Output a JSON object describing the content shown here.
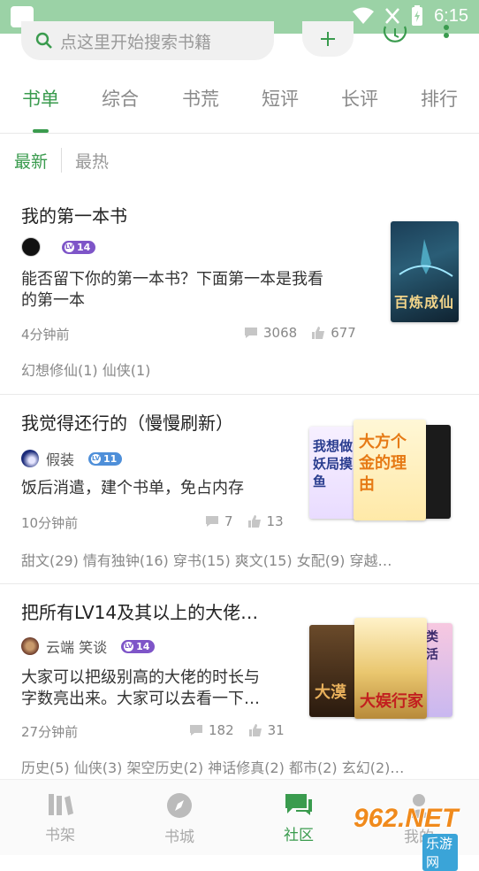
{
  "status": {
    "time": "6:15"
  },
  "search": {
    "placeholder": "点这里开始搜索书籍"
  },
  "tabs": [
    "书单",
    "综合",
    "书荒",
    "短评",
    "长评",
    "排行"
  ],
  "subtabs": [
    "最新",
    "最热"
  ],
  "colors": {
    "accent": "#3a9b4e"
  },
  "cards": [
    {
      "title": "我的第一本书",
      "author": "",
      "level": "14",
      "desc1": "能否留下你的第一本书？下面第一本是我看",
      "desc2": "的第一本",
      "time": "4分钟前",
      "comments": "3068",
      "likes": "677",
      "tags": "幻想修仙(1) 仙侠(1)",
      "covers": [
        "百炼成仙"
      ]
    },
    {
      "title": "我觉得还行的（慢慢刷新）",
      "author": "假装",
      "level": "11",
      "desc1": "饭后消遣，建个书单，免占内存",
      "time": "10分钟前",
      "comments": "7",
      "likes": "13",
      "tags": "甜文(29) 情有独钟(16) 穿书(15) 爽文(15) 女配(9) 穿越…",
      "covers": [
        "我想做妖局摸鱼",
        "大方个金的理由"
      ]
    },
    {
      "title": "把所有LV14及其以上的大佬…",
      "author": "云端 笑谈",
      "level": "14",
      "desc1": "大家可以把级别高的大佬的时长与",
      "desc2": "字数亮出来。大家可以去看一下…",
      "time": "27分钟前",
      "comments": "182",
      "likes": "31",
      "tags": "历史(5) 仙侠(3) 架空历史(2) 神话修真(2) 都市(2) 玄幻(2)…",
      "covers": [
        "大漠",
        "大娱行家",
        "人类生活"
      ]
    }
  ],
  "nav": [
    "书架",
    "书城",
    "社区",
    "我的"
  ],
  "watermark": {
    "big": "962.NET",
    "small": "乐游网"
  }
}
